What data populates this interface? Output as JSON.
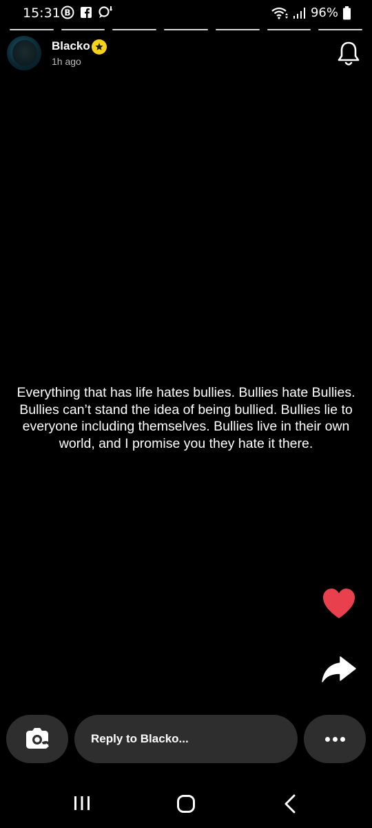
{
  "status_bar": {
    "time": "15:31",
    "battery": "96%",
    "left_icons": [
      "b-circle-icon",
      "facebook-icon",
      "chat-bubble-icon"
    ],
    "right_icons": [
      "wifi-icon",
      "signal-icon",
      "battery-icon"
    ]
  },
  "story": {
    "segments": 7,
    "username": "Blacko",
    "timestamp": "1h ago",
    "text": "Everything that has life hates bullies. Bullies hate Bullies. Bullies can’t stand the idea of being bullied. Bullies lie to everyone including themselves. Bullies live in their own world, and I promise you they hate it there."
  },
  "reply": {
    "placeholder": "Reply to Blacko..."
  },
  "colors": {
    "background": "#000000",
    "heart": "#e8414d",
    "badge": "#f7d21c",
    "pill": "#2e2e2e"
  }
}
